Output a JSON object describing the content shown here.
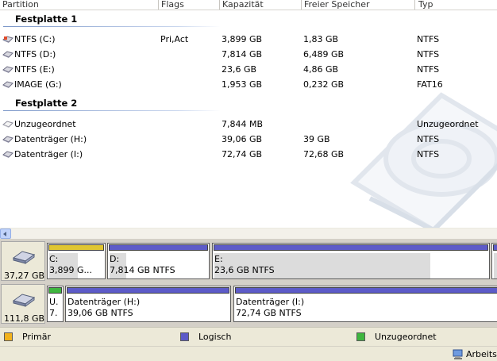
{
  "columns": {
    "partition": "Partition",
    "flags": "Flags",
    "capacity": "Kapazität",
    "free": "Freier Speicher",
    "type": "Typ"
  },
  "groups": [
    {
      "title": "Festplatte 1",
      "rows": [
        {
          "name": "NTFS (C:)",
          "flags": "Pri,Act",
          "capacity": "3,899 GB",
          "free": "1,83 GB",
          "type": "NTFS",
          "icon": "system-drive-icon"
        },
        {
          "name": "NTFS (D:)",
          "flags": "",
          "capacity": "7,814 GB",
          "free": "6,489 GB",
          "type": "NTFS",
          "icon": "partition-drive-icon"
        },
        {
          "name": "NTFS (E:)",
          "flags": "",
          "capacity": "23,6 GB",
          "free": "4,86 GB",
          "type": "NTFS",
          "icon": "partition-drive-icon"
        },
        {
          "name": "IMAGE (G:)",
          "flags": "",
          "capacity": "1,953 GB",
          "free": "0,232 GB",
          "type": "FAT16",
          "icon": "partition-drive-icon"
        }
      ]
    },
    {
      "title": "Festplatte 2",
      "rows": [
        {
          "name": "Unzugeordnet",
          "flags": "",
          "capacity": "7,844 MB",
          "free": "",
          "type": "Unzugeordnet",
          "icon": "unallocated-drive-icon"
        },
        {
          "name": "Datenträger (H:)",
          "flags": "",
          "capacity": "39,06 GB",
          "free": "39 GB",
          "type": "NTFS",
          "icon": "partition-drive-icon"
        },
        {
          "name": "Datenträger (I:)",
          "flags": "",
          "capacity": "72,74 GB",
          "free": "72,68 GB",
          "type": "NTFS",
          "icon": "partition-drive-icon"
        }
      ]
    }
  ],
  "disks": [
    {
      "size": "37,27 GB",
      "partitions": [
        {
          "line1": "C:",
          "line2": "3,899 G...",
          "kind": "primary",
          "used": 0.53
        },
        {
          "line1": "D:",
          "line2": "7,814 GB  NTFS",
          "kind": "logical",
          "used": 0.17
        },
        {
          "line1": "E:",
          "line2": "23,6 GB  NTFS",
          "kind": "logical",
          "used": 0.79
        },
        {
          "line1": "",
          "line2": "",
          "kind": "logical",
          "used": 0.88
        }
      ]
    },
    {
      "size": "111,8 GB",
      "partitions": [
        {
          "line1": "U.",
          "line2": "7.",
          "kind": "unallocated",
          "used": 0
        },
        {
          "line1": "Datenträger (H:)",
          "line2": "39,06 GB  NTFS",
          "kind": "logical",
          "used": 0.0
        },
        {
          "line1": "Datenträger (I:)",
          "line2": "72,74 GB  NTFS",
          "kind": "logical",
          "used": 0.0
        }
      ]
    }
  ],
  "legend": {
    "primary": "Primär",
    "logical": "Logisch",
    "unallocated": "Unzugeordnet"
  },
  "colors": {
    "primary": "#e0c632",
    "logical": "#5d5bc8",
    "unallocated": "#3fb63f",
    "primary_legend": "#f2b21c"
  },
  "status": {
    "text": "Arbeitsp",
    "icon": "computer-icon"
  }
}
